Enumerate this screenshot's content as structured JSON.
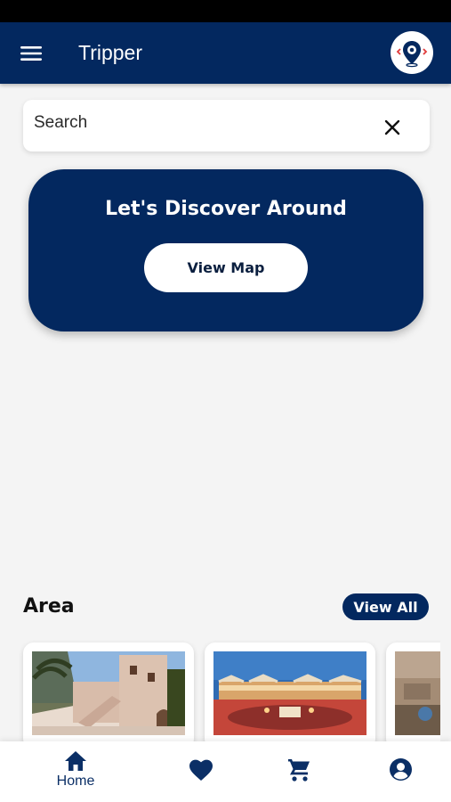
{
  "app": {
    "title": "Tripper"
  },
  "search": {
    "placeholder": "Search",
    "value": ""
  },
  "hero": {
    "title": "Let's Discover Around",
    "button_label": "View Map"
  },
  "area": {
    "title": "Area",
    "view_all_label": "View All"
  },
  "bottom_nav": [
    {
      "icon": "home-icon",
      "label": "Home",
      "active": true
    },
    {
      "icon": "heart-icon",
      "label": ""
    },
    {
      "icon": "cart-icon",
      "label": ""
    },
    {
      "icon": "account-icon",
      "label": ""
    }
  ],
  "colors": {
    "primary": "#03285f",
    "background": "#f4f4f4",
    "logo_accent": "#e03a3a"
  }
}
